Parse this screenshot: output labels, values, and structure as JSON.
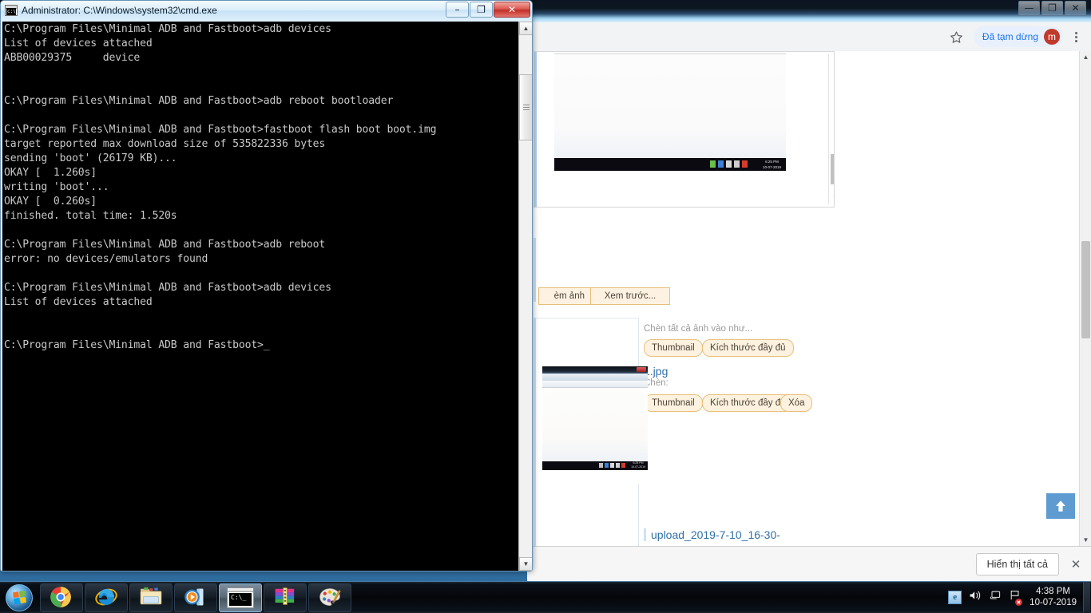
{
  "console_window": {
    "title": "Administrator: C:\\Windows\\system32\\cmd.exe",
    "icon": "console-icon",
    "buttons": {
      "minimize": "–",
      "maximize": "❐",
      "close": "✕"
    },
    "text": "C:\\Program Files\\Minimal ADB and Fastboot>adb devices\nList of devices attached\nABB00029375     device\n\n\nC:\\Program Files\\Minimal ADB and Fastboot>adb reboot bootloader\n\nC:\\Program Files\\Minimal ADB and Fastboot>fastboot flash boot boot.img\ntarget reported max download size of 535822336 bytes\nsending 'boot' (26179 KB)...\nOKAY [  1.260s]\nwriting 'boot'...\nOKAY [  0.260s]\nfinished. total time: 1.520s\n\nC:\\Program Files\\Minimal ADB and Fastboot>adb reboot\nerror: no devices/emulators found\n\nC:\\Program Files\\Minimal ADB and Fastboot>adb devices\nList of devices attached\n\n\nC:\\Program Files\\Minimal ADB and Fastboot>_",
    "scrollbar": {
      "up_arrow": "▲",
      "down_arrow": "▼"
    }
  },
  "browser": {
    "window_buttons": {
      "minimize": "—",
      "maximize": "❐",
      "close": "✕"
    },
    "toolbar": {
      "bookmark_icon": "star-icon",
      "profile_label": "Đã tạm dừng",
      "profile_avatar": "m",
      "menu_icon": "three-dot-menu-icon"
    },
    "scrollbar": {
      "up_arrow": "▲",
      "down_arrow": "▼"
    },
    "scroll_top_button": "⬆",
    "download_shelf": {
      "file_name": "upload_2019-7-10_16-30-",
      "show_all_label": "Hiển thị tất cả",
      "close_label": "✕"
    }
  },
  "page": {
    "attach_button": "èm ảnh",
    "preview_button": "Xem trước...",
    "insert_all_label": "Chèn tất cả ảnh vào như...",
    "insert_all_thumbnail": "Thumbnail",
    "insert_all_fullsize": "Kích thước đầy đủ",
    "file": {
      "name": "1.jpg",
      "insert_label": "Chèn:",
      "thumbnail_button": "Thumbnail",
      "fullsize_button": "Kích thước đầy đủ",
      "delete_button": "Xóa"
    },
    "embedded_screenshot_1": {
      "clock_time": "6:25 PM",
      "clock_date": "10-07-2019"
    },
    "embedded_screenshot_2": {
      "clock_time": "6:25 PM",
      "clock_date": "10-07-2019"
    }
  },
  "taskbar": {
    "start_label": "start-orb",
    "items": [
      {
        "name": "taskbar-item-chrome",
        "icon": "chrome-icon"
      },
      {
        "name": "taskbar-item-internet-explorer",
        "icon": "internet-explorer-icon"
      },
      {
        "name": "taskbar-item-file-explorer",
        "icon": "folder-icon"
      },
      {
        "name": "taskbar-item-media-player",
        "icon": "media-player-icon"
      },
      {
        "name": "taskbar-item-command-prompt",
        "icon": "console-icon"
      },
      {
        "name": "taskbar-item-winrar",
        "icon": "winrar-icon"
      },
      {
        "name": "taskbar-item-paint",
        "icon": "paint-palette-icon"
      }
    ],
    "tray": {
      "icons": [
        "internet-explorer-icon",
        "volume-icon",
        "network-icon",
        "action-center-flag-icon"
      ],
      "time": "4:38 PM",
      "date": "10-07-2019"
    }
  },
  "colors": {
    "console_bg": "#000000",
    "console_text": "#c8c8c8",
    "chrome_accent": "#1a73e8",
    "avatar": "#c0392b",
    "button_orange_bg": "#fdf2e0",
    "button_orange_border": "#e8bf7a",
    "link_blue": "#2f6fa8",
    "scroll_top_blue": "#5e9bd1"
  }
}
